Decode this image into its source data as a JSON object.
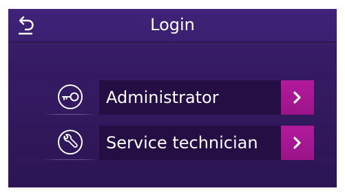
{
  "header": {
    "title": "Login",
    "back_icon": "back-arrow-icon"
  },
  "options": [
    {
      "label": "Administrator",
      "icon": "key-icon",
      "arrow_icon": "chevron-right-icon"
    },
    {
      "label": "Service technician",
      "icon": "wrench-icon",
      "arrow_icon": "chevron-right-icon"
    }
  ],
  "colors": {
    "background": "#361b64",
    "button_background": "#240e43",
    "arrow_accent": "#a8178f",
    "text": "#ffffff"
  }
}
